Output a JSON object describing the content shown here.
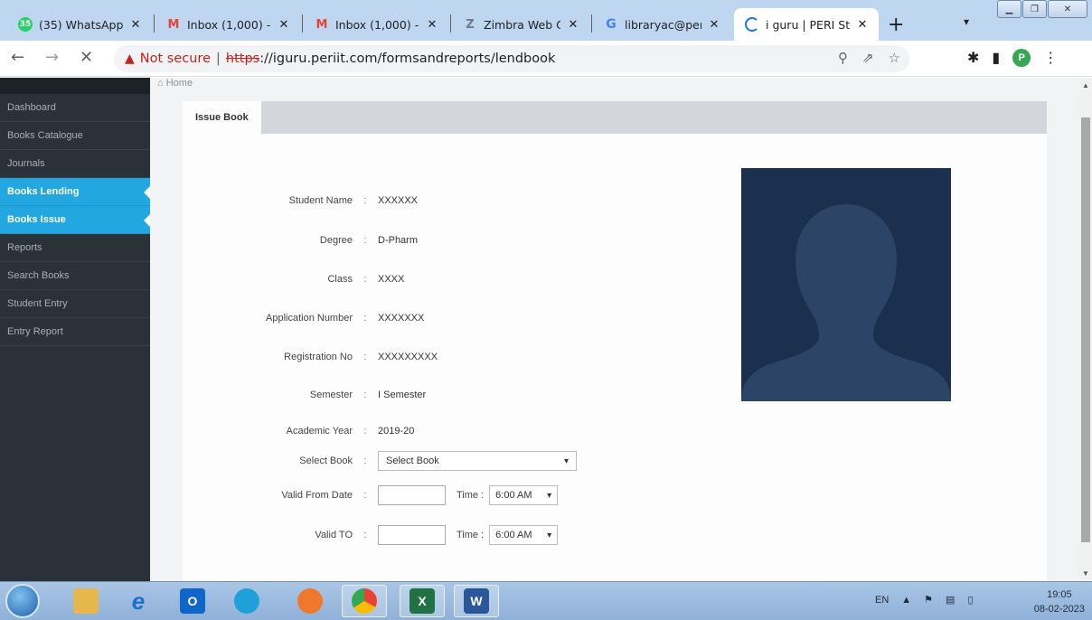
{
  "browser": {
    "tabs": [
      {
        "label": "(35) WhatsApp",
        "fav_text": "35",
        "fav_color": "#25d366"
      },
      {
        "label": "Inbox (1,000) -",
        "fav_text": "M",
        "fav_color": "#ea4335"
      },
      {
        "label": "Inbox (1,000) -",
        "fav_text": "M",
        "fav_color": "#ea4335"
      },
      {
        "label": "Zimbra Web Cl",
        "fav_text": "Z",
        "fav_color": "#7f8c8d"
      },
      {
        "label": "libraryac@peri.",
        "fav_text": "G",
        "fav_color": "#4285f4"
      },
      {
        "label": "i guru | PERI Stu",
        "fav_text": "",
        "fav_color": "#1a73e8"
      }
    ],
    "address": {
      "not_secure": "Not secure",
      "scheme": "https",
      "rest": "://iguru.periit.com/formsandreports/lendbook"
    },
    "profile_initial": "P"
  },
  "breadcrumb": "Home",
  "sidebar": {
    "items": [
      {
        "label": "Dashboard"
      },
      {
        "label": "Books Catalogue"
      },
      {
        "label": "Journals"
      },
      {
        "label": "Books Lending"
      },
      {
        "label": "Books Issue"
      },
      {
        "label": "Reports"
      },
      {
        "label": "Search Books"
      },
      {
        "label": "Student Entry"
      },
      {
        "label": "Entry Report"
      }
    ]
  },
  "panel": {
    "tab_label": "Issue Book"
  },
  "form": {
    "student_name": {
      "label": "Student Name",
      "value": "XXXXXX"
    },
    "degree": {
      "label": "Degree",
      "value": "D-Pharm"
    },
    "class": {
      "label": "Class",
      "value": "XXXX"
    },
    "application_number": {
      "label": "Application Number",
      "value": "XXXXXXX"
    },
    "registration_no": {
      "label": "Registration No",
      "value": "XXXXXXXXX"
    },
    "semester": {
      "label": "Semester",
      "value": "I Semester"
    },
    "academic_year": {
      "label": "Academic Year",
      "value": "2019-20"
    },
    "select_book": {
      "label": "Select Book",
      "value": "Select Book"
    },
    "valid_from": {
      "label": "Valid From Date",
      "time_label": "Time :",
      "time_value": "6:00 AM"
    },
    "valid_to": {
      "label": "Valid TO",
      "time_label": "Time :",
      "time_value": "6:00 AM"
    },
    "colon": ":"
  },
  "taskbar": {
    "language": "EN",
    "time": "19:05",
    "date": "08-02-2023"
  },
  "colors": {
    "sidebar_bg": "#2a3138",
    "active_item": "#22a7e0",
    "photo_bg": "#1b2f4e"
  }
}
